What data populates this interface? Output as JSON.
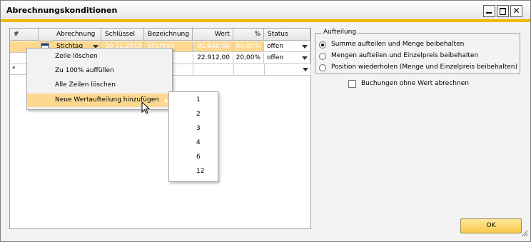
{
  "window": {
    "title": "Abrechnungskonditionen"
  },
  "grid": {
    "headers": [
      "#",
      "",
      "Abrechnung",
      "Schlüssel",
      "Bezeichnung",
      "Wert",
      "%",
      "Status"
    ],
    "rows": [
      {
        "abrechnung": "Stichtag",
        "schluessel": "30.11.2013",
        "bezeichnung": "Stichtag",
        "wert": "91.648,00",
        "prozent": "80,00%",
        "status": "offen"
      },
      {
        "wert": "22.912,00",
        "prozent": "20,00%",
        "status": "offen"
      },
      {
        "marker": "*"
      }
    ]
  },
  "context_menu": {
    "items": [
      "Zeile löschen",
      "Zu 100% auffüllen",
      "Alle Zeilen löschen",
      "Neue Wertaufteilung hinzufügen"
    ]
  },
  "submenu": {
    "items": [
      "1",
      "2",
      "3",
      "4",
      "6",
      "12"
    ]
  },
  "aufteilung": {
    "legend": "Aufteilung",
    "options": [
      "Summe aufteilen und Menge beibehalten",
      "Mengen aufteilen und Einzelpreis beibehalten",
      "Position wiederholen (Menge und Einzelpreis beibehalten)"
    ],
    "selected": 0
  },
  "checkbox": {
    "label": "Buchungen ohne Wert abrechnen",
    "checked": false
  },
  "ok_button": {
    "label": "OK"
  },
  "colors": {
    "accent": "#f0b800",
    "highlight": "#fcd98f"
  }
}
